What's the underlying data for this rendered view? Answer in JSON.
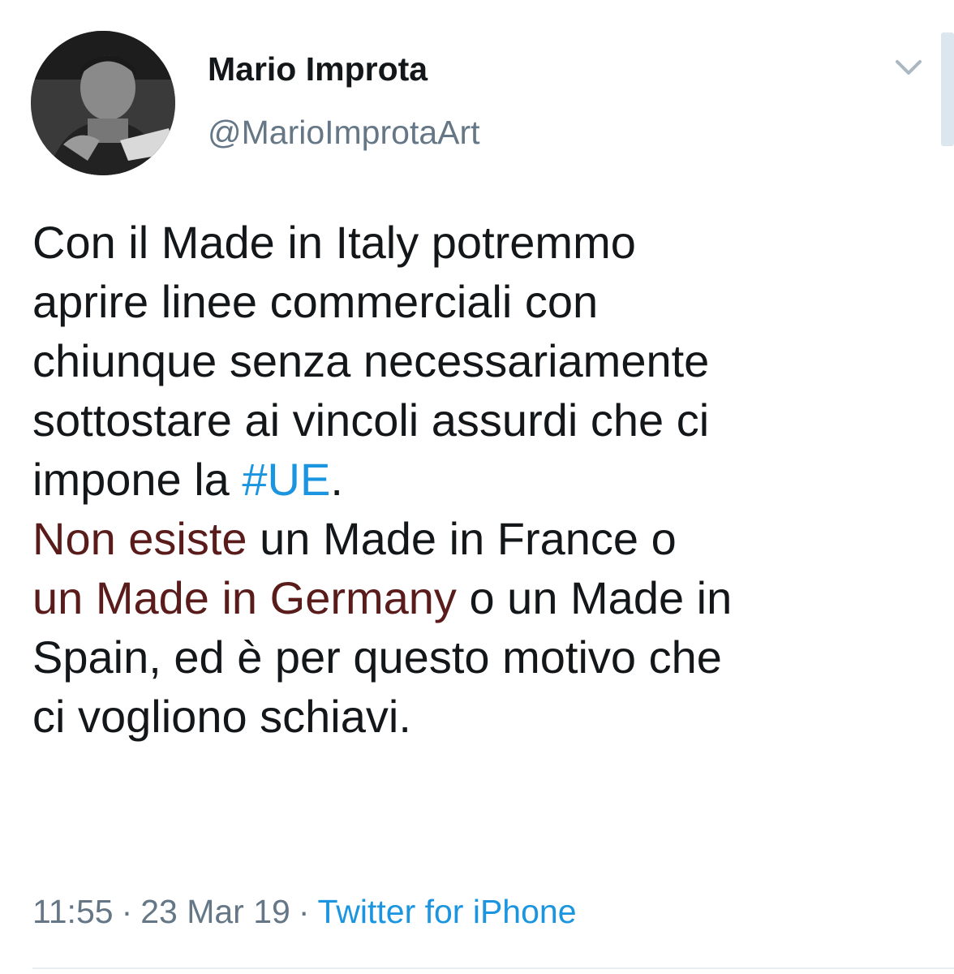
{
  "author": {
    "name": "Mario Improta",
    "handle": "@MarioImprotaArt"
  },
  "tweet": {
    "lines": [
      "Con il Made in Italy potremmo",
      "aprire linee commerciali con",
      "chiunque senza necessariamente",
      "sottostare ai vincoli assurdi che ci"
    ],
    "line5_prefix": "impone la ",
    "hashtag": "#UE",
    "line5_suffix": ".",
    "line6_highlight": "Non esiste",
    "line6_rest": " un Made in France o",
    "line7_highlight": "un Made in Germany",
    "line7_rest": " o un Made in",
    "line8": "Spain, ed è per questo motivo che",
    "line9": "ci vogliono schiavi."
  },
  "meta": {
    "time": "11:55",
    "separator": "·",
    "date": "23 Mar 19",
    "source": "Twitter for iPhone"
  },
  "icons": {
    "caret": "chevron-down-icon",
    "avatar": "profile-photo"
  },
  "colors": {
    "link": "#1b95e0",
    "secondary_text": "#657786",
    "primary_text": "#14171a",
    "highlight": "#ec6e6e"
  }
}
